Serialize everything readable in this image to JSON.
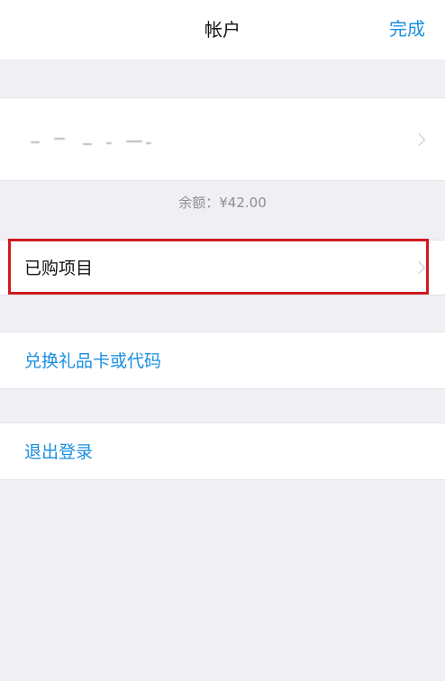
{
  "navbar": {
    "title": "帐户",
    "done_label": "完成"
  },
  "account": {
    "apple_id_row": {
      "value_hidden": true,
      "chevron_icon": "chevron-right-icon"
    },
    "balance_text": "余额：¥42.00"
  },
  "menu": {
    "purchased_label": "已购项目",
    "redeem_label": "兑换礼品卡或代码",
    "signout_label": "退出登录"
  },
  "colors": {
    "accent": "#1a8fe0",
    "background": "#efeff4",
    "highlight_border": "#d21a1f",
    "secondary_text": "#8e8e93"
  }
}
